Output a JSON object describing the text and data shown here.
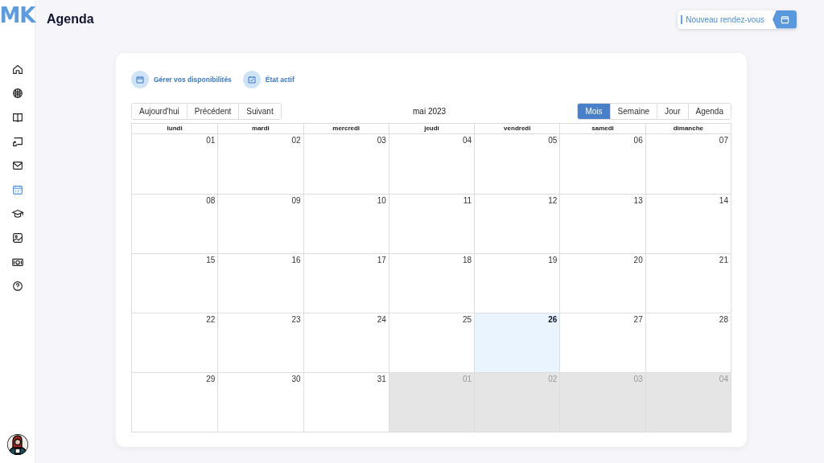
{
  "logo": {
    "text": "MK"
  },
  "sidebar": {
    "items": [
      {
        "selected": false
      },
      {
        "selected": false
      },
      {
        "selected": false
      },
      {
        "selected": false
      },
      {
        "selected": false
      },
      {
        "selected": true
      },
      {
        "selected": false
      },
      {
        "selected": false
      },
      {
        "selected": false
      },
      {
        "selected": false
      }
    ]
  },
  "header": {
    "title": "Agenda",
    "new_button": "Nouveau rendez-vous"
  },
  "actions": [
    {
      "label": "Gérer vos disponibilités",
      "kind": "calendar"
    },
    {
      "label": "État actif",
      "kind": "check"
    }
  ],
  "toolbar": {
    "nav": [
      "Aujourd'hui",
      "Précédent",
      "Suivant"
    ],
    "label": "mai 2023",
    "views": [
      {
        "label": "Mois",
        "selected": true
      },
      {
        "label": "Semaine",
        "selected": false
      },
      {
        "label": "Jour",
        "selected": false
      },
      {
        "label": "Agenda",
        "selected": false
      }
    ]
  },
  "calendar": {
    "weekdays": [
      "lundi",
      "mardi",
      "mercredi",
      "jeudi",
      "vendredi",
      "samedi",
      "dimanche"
    ],
    "days": [
      {
        "day": "01",
        "kind": "current"
      },
      {
        "day": "02",
        "kind": "current"
      },
      {
        "day": "03",
        "kind": "current"
      },
      {
        "day": "04",
        "kind": "current"
      },
      {
        "day": "05",
        "kind": "current"
      },
      {
        "day": "06",
        "kind": "current"
      },
      {
        "day": "07",
        "kind": "current"
      },
      {
        "day": "08",
        "kind": "current"
      },
      {
        "day": "09",
        "kind": "current"
      },
      {
        "day": "10",
        "kind": "current"
      },
      {
        "day": "11",
        "kind": "current"
      },
      {
        "day": "12",
        "kind": "current"
      },
      {
        "day": "13",
        "kind": "current"
      },
      {
        "day": "14",
        "kind": "current"
      },
      {
        "day": "15",
        "kind": "current"
      },
      {
        "day": "16",
        "kind": "current"
      },
      {
        "day": "17",
        "kind": "current"
      },
      {
        "day": "18",
        "kind": "current"
      },
      {
        "day": "19",
        "kind": "current"
      },
      {
        "day": "20",
        "kind": "current"
      },
      {
        "day": "21",
        "kind": "current"
      },
      {
        "day": "22",
        "kind": "current"
      },
      {
        "day": "23",
        "kind": "current"
      },
      {
        "day": "24",
        "kind": "current"
      },
      {
        "day": "25",
        "kind": "current"
      },
      {
        "day": "26",
        "kind": "today"
      },
      {
        "day": "27",
        "kind": "current"
      },
      {
        "day": "28",
        "kind": "current"
      },
      {
        "day": "29",
        "kind": "current"
      },
      {
        "day": "30",
        "kind": "current"
      },
      {
        "day": "31",
        "kind": "current"
      },
      {
        "day": "01",
        "kind": "other"
      },
      {
        "day": "02",
        "kind": "other"
      },
      {
        "day": "03",
        "kind": "other"
      },
      {
        "day": "04",
        "kind": "other"
      }
    ]
  }
}
